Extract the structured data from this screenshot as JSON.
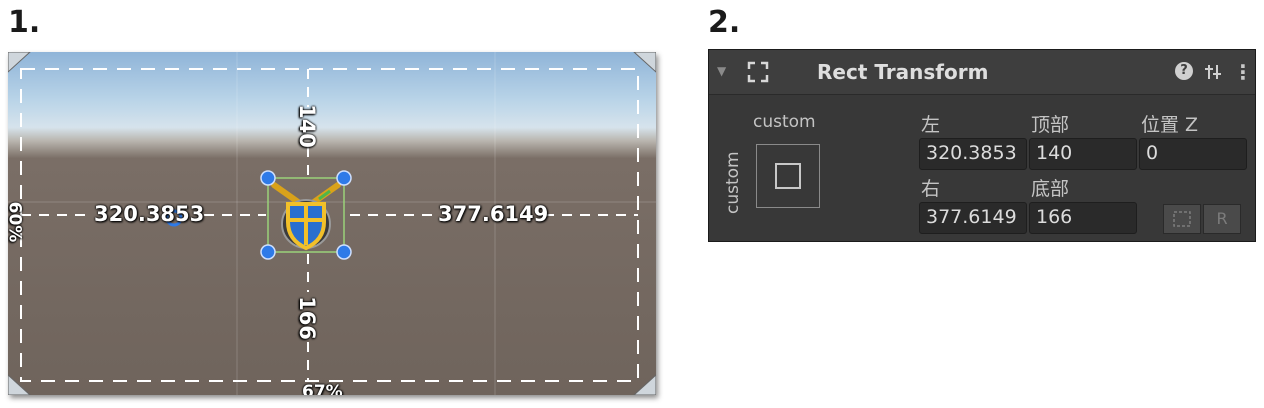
{
  "steps": {
    "one": "1.",
    "two": "2."
  },
  "scene": {
    "top_value": "140",
    "bottom_value": "166",
    "left_value": "320.3853",
    "right_value": "377.6149",
    "left_edge_percent": "60%",
    "bottom_edge_percent": "67%"
  },
  "inspector": {
    "title": "Rect Transform",
    "anchor_h_label": "custom",
    "anchor_v_label": "custom",
    "left_label": "左",
    "top_label": "顶部",
    "pos_z_label": "位置 Z",
    "right_label": "右",
    "bottom_label": "底部",
    "left_value": "320.3853",
    "top_value": "140",
    "pos_z_value": "0",
    "right_value": "377.6149",
    "bottom_value": "166",
    "raw_edit_button": "R"
  },
  "icons": {
    "fold": "triangle-down",
    "component": "rect-transform",
    "help": "question-circle",
    "presets": "sliders",
    "menu": "kebab",
    "blueprint": "dashed-rect"
  },
  "colors": {
    "panel_bg": "#383838",
    "field_bg": "#2a2a2a",
    "handle_blue": "#2e7ae8",
    "guide_white": "#ffffff"
  }
}
